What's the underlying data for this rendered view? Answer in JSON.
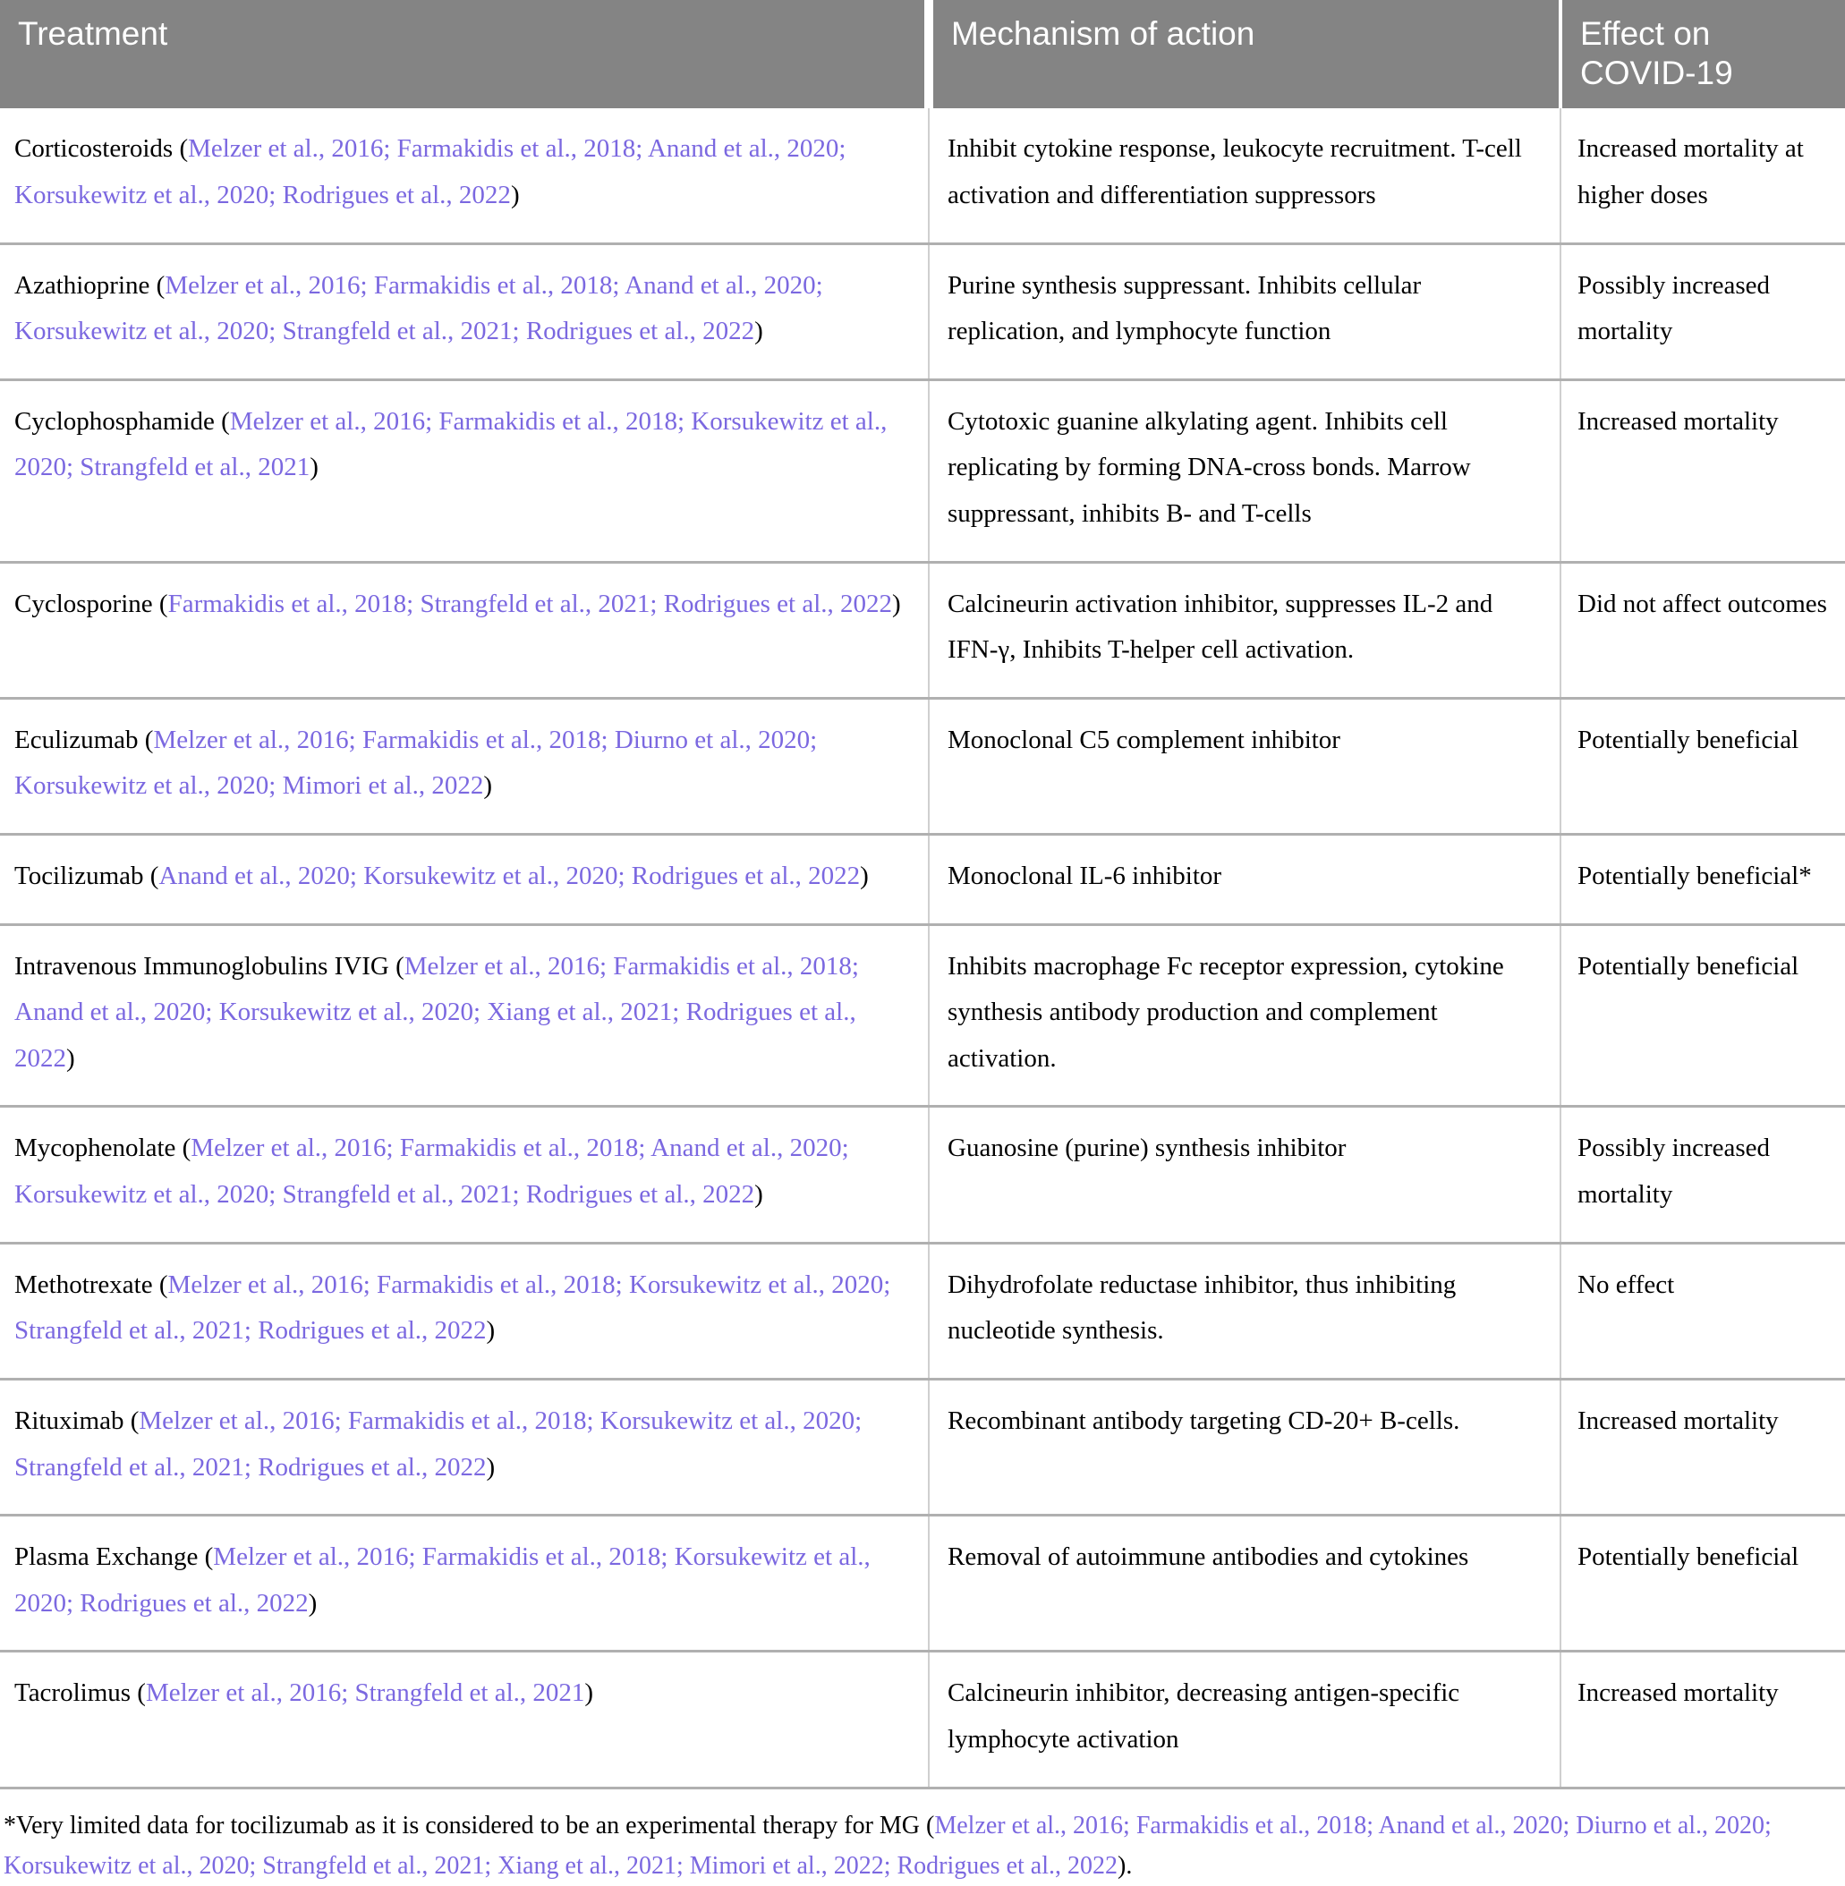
{
  "table": {
    "columns": [
      {
        "id": "treatment",
        "label": "Treatment"
      },
      {
        "id": "mechanism",
        "label": "Mechanism of action"
      },
      {
        "id": "effect",
        "label": "Effect on\nCOVID-19"
      }
    ],
    "rows": [
      {
        "treatment_name": "Corticosteroids ",
        "treatment_citation": "(Melzer et al., 2016; Farmakidis et al., 2018; Anand et al., 2020; Korsukewitz et al., 2020; Rodrigues et al., 2022)",
        "mechanism": "Inhibit cytokine response, leukocyte recruitment. T-cell activation and differentiation suppressors",
        "effect": "Increased mortality at higher doses"
      },
      {
        "treatment_name": "Azathioprine ",
        "treatment_citation": "(Melzer et al., 2016; Farmakidis et al., 2018; Anand et al., 2020; Korsukewitz et al., 2020; Strangfeld et al., 2021; Rodrigues et al., 2022)",
        "mechanism": "Purine synthesis suppressant. Inhibits cellular replication, and lymphocyte function",
        "effect": "Possibly increased mortality"
      },
      {
        "treatment_name": "Cyclophosphamide ",
        "treatment_citation": "(Melzer et al., 2016; Farmakidis et al., 2018; Korsukewitz et al., 2020; Strangfeld et al., 2021)",
        "mechanism": "Cytotoxic guanine alkylating agent. Inhibits cell replicating by forming DNA-cross bonds. Marrow suppressant, inhibits B- and T-cells",
        "effect": "Increased mortality"
      },
      {
        "treatment_name": "Cyclosporine ",
        "treatment_citation": "(Farmakidis et al., 2018; Strangfeld et al., 2021; Rodrigues et al., 2022)",
        "mechanism": "Calcineurin activation inhibitor, suppresses IL-2 and IFN-γ, Inhibits T-helper cell activation.",
        "effect": "Did not affect outcomes"
      },
      {
        "treatment_name": "Eculizumab ",
        "treatment_citation": "(Melzer et al., 2016; Farmakidis et al., 2018; Diurno et al., 2020; Korsukewitz et al., 2020; Mimori et al., 2022)",
        "mechanism": "Monoclonal C5 complement inhibitor",
        "effect": "Potentially beneficial"
      },
      {
        "treatment_name": "Tocilizumab ",
        "treatment_citation": "(Anand et al., 2020; Korsukewitz et al., 2020; Rodrigues et al., 2022)",
        "mechanism": "Monoclonal IL-6 inhibitor",
        "effect": "Potentially beneficial*"
      },
      {
        "treatment_name": "Intravenous Immunoglobulins IVIG ",
        "treatment_citation": "(Melzer et al., 2016; Farmakidis et al., 2018; Anand et al., 2020; Korsukewitz et al., 2020; Xiang et al., 2021; Rodrigues et al., 2022)",
        "mechanism": "Inhibits macrophage Fc receptor expression, cytokine synthesis antibody production and complement activation.",
        "effect": "Potentially beneficial"
      },
      {
        "treatment_name": "Mycophenolate ",
        "treatment_citation": "(Melzer et al., 2016; Farmakidis et al., 2018; Anand et al., 2020; Korsukewitz et al., 2020; Strangfeld et al., 2021; Rodrigues et al., 2022)",
        "mechanism": "Guanosine (purine) synthesis inhibitor",
        "effect": "Possibly increased mortality"
      },
      {
        "treatment_name": "Methotrexate ",
        "treatment_citation": "(Melzer et al., 2016; Farmakidis et al., 2018; Korsukewitz et al., 2020; Strangfeld et al., 2021; Rodrigues et al., 2022)",
        "mechanism": "Dihydrofolate reductase inhibitor, thus inhibiting nucleotide synthesis.",
        "effect": "No effect"
      },
      {
        "treatment_name": "Rituximab ",
        "treatment_citation": "(Melzer et al., 2016; Farmakidis et al., 2018; Korsukewitz et al., 2020; Strangfeld et al., 2021; Rodrigues et al., 2022)",
        "mechanism": "Recombinant antibody targeting CD-20+ B-cells.",
        "effect": "Increased mortality"
      },
      {
        "treatment_name": "Plasma Exchange ",
        "treatment_citation": "(Melzer et al., 2016; Farmakidis et al., 2018; Korsukewitz et al., 2020; Rodrigues et al., 2022)",
        "mechanism": "Removal of autoimmune antibodies and cytokines",
        "effect": "Potentially beneficial"
      },
      {
        "treatment_name": "Tacrolimus ",
        "treatment_citation": "(Melzer et al., 2016; Strangfeld et al., 2021)",
        "mechanism": "Calcineurin inhibitor, decreasing antigen-specific lymphocyte activation",
        "effect": "Increased mortality"
      }
    ]
  },
  "footnote": {
    "lead": "*Very limited data for tocilizumab as it is considered to be an experimental therapy for MG (",
    "citation": "Melzer et al., 2016; Farmakidis et al., 2018; Anand et al., 2020; Diurno et al., 2020; Korsukewitz et al., 2020; Strangfeld et al., 2021; Xiang et al., 2021; Mimori et al., 2022; Rodrigues et al., 2022",
    "tail": ")."
  },
  "colors": {
    "header_background": "#848484",
    "header_text": "#ffffff",
    "citation_link": "#7b68e0",
    "row_border": "#b0b0b0",
    "cell_divider": "#cfcfcf",
    "body_text": "#000000",
    "page_background": "#ffffff"
  }
}
